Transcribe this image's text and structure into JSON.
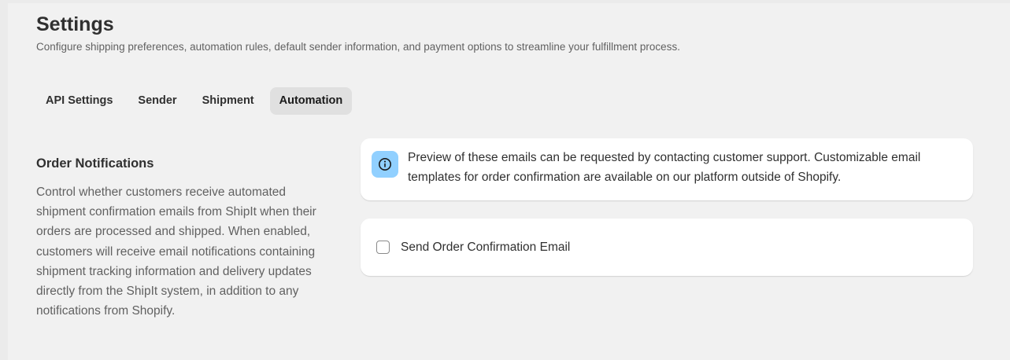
{
  "header": {
    "title": "Settings",
    "subtitle": "Configure shipping preferences, automation rules, default sender information, and payment options to streamline your fulfillment process."
  },
  "tabs": [
    {
      "label": "API Settings",
      "active": false
    },
    {
      "label": "Sender",
      "active": false
    },
    {
      "label": "Shipment",
      "active": false
    },
    {
      "label": "Automation",
      "active": true
    }
  ],
  "order_notifications": {
    "title": "Order Notifications",
    "description": "Control whether customers receive automated shipment confirmation emails from ShipIt when their orders are processed and shipped. When enabled, customers will receive email notifications containing shipment tracking information and delivery updates directly from the ShipIt system, in addition to any notifications from Shopify."
  },
  "info_banner": {
    "icon": "info-icon",
    "text": "Preview of these emails can be requested by contacting customer support. Customizable email templates for order confirmation are available on our platform outside of Shopify."
  },
  "confirmation_option": {
    "label": "Send Order Confirmation Email",
    "checked": false
  },
  "colors": {
    "background": "#f1f1f1",
    "active_tab": "#e0e0e0",
    "info_badge": "#91d0ff",
    "card": "#ffffff"
  }
}
